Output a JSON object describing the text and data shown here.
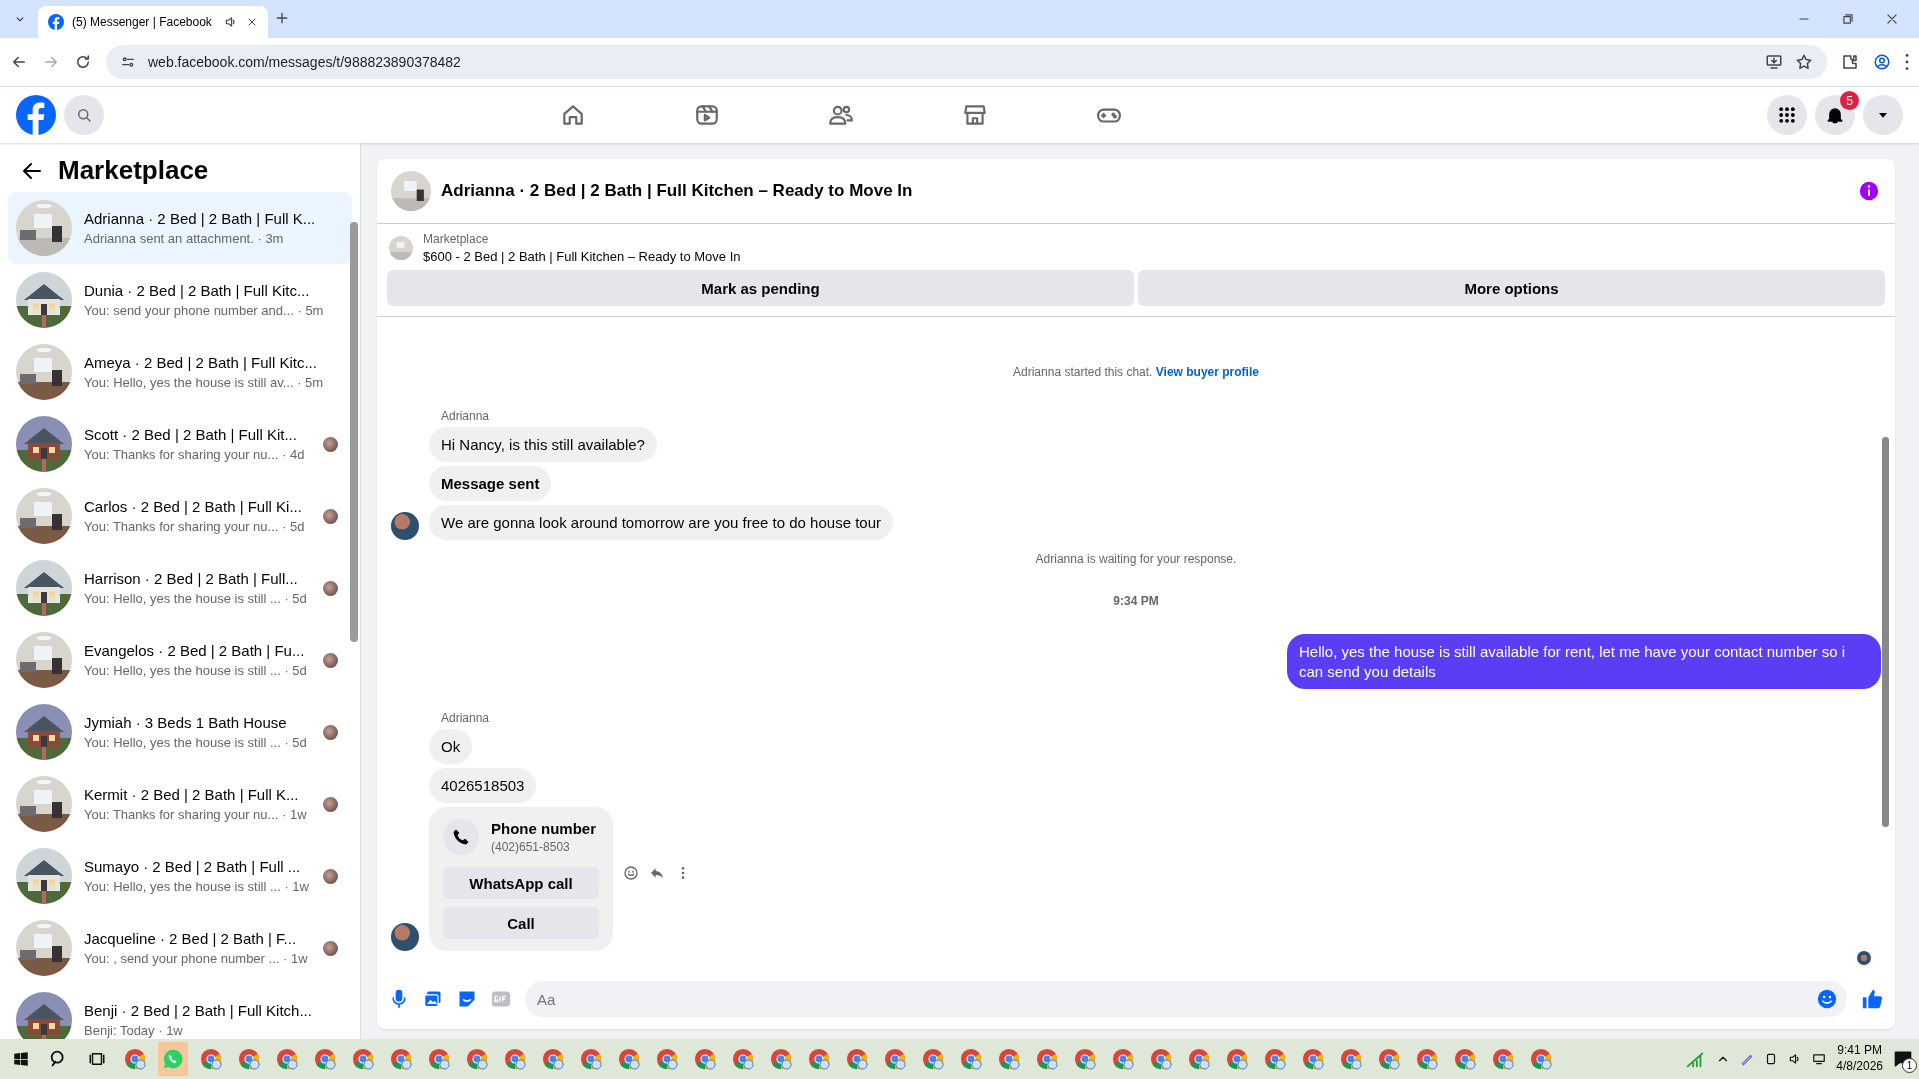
{
  "browser": {
    "tab_title": "(5) Messenger | Facebook",
    "url": "web.facebook.com/messages/t/988823890378482"
  },
  "header": {
    "notification_count": "5"
  },
  "sidebar": {
    "title": "Marketplace",
    "conversations": [
      {
        "name": "Adrianna · 2 Bed | 2 Bath | Full K...",
        "preview": "Adrianna sent an attachment. · 3m",
        "selected": true,
        "seen": false
      },
      {
        "name": "Dunia · 2 Bed | 2 Bath | Full Kitc...",
        "preview": "You: send your phone number and... · 5m",
        "selected": false,
        "seen": false
      },
      {
        "name": "Ameya · 2 Bed | 2 Bath | Full Kitc...",
        "preview": "You: Hello, yes the house is still av... · 5m",
        "selected": false,
        "seen": false
      },
      {
        "name": "Scott · 2 Bed | 2 Bath | Full Kit...",
        "preview": "You: Thanks for sharing your nu... · 4d",
        "selected": false,
        "seen": true
      },
      {
        "name": "Carlos · 2 Bed | 2 Bath | Full Ki...",
        "preview": "You: Thanks for sharing your nu... · 5d",
        "selected": false,
        "seen": true
      },
      {
        "name": "Harrison · 2 Bed | 2 Bath | Full...",
        "preview": "You: Hello, yes the house is still ... · 5d",
        "selected": false,
        "seen": true
      },
      {
        "name": "Evangelos · 2 Bed | 2 Bath | Fu...",
        "preview": "You: Hello, yes the house is still ... · 5d",
        "selected": false,
        "seen": true
      },
      {
        "name": "Jymiah · 3 Beds 1 Bath House",
        "preview": "You: Hello, yes the house is still ... · 5d",
        "selected": false,
        "seen": true
      },
      {
        "name": "Kermit · 2 Bed | 2 Bath | Full K...",
        "preview": "You: Thanks for sharing your nu... · 1w",
        "selected": false,
        "seen": true
      },
      {
        "name": "Sumayo · 2 Bed | 2 Bath | Full ...",
        "preview": "You: Hello, yes the house is still ... · 1w",
        "selected": false,
        "seen": true
      },
      {
        "name": "Jacqueline · 2 Bed | 2 Bath | F...",
        "preview": "You: , send your phone number ... · 1w",
        "selected": false,
        "seen": true
      },
      {
        "name": "Benji · 2 Bed | 2 Bath | Full Kitch...",
        "preview": "Benji: Today · 1w",
        "selected": false,
        "seen": false
      }
    ]
  },
  "chat": {
    "title": "Adrianna · 2 Bed | 2 Bath | Full Kitchen – Ready to Move In",
    "listing": {
      "label": "Marketplace",
      "title": "$600 - 2 Bed | 2 Bath | Full Kitchen – Ready to Move In"
    },
    "actions": [
      "Mark as pending",
      "More options"
    ],
    "messages": [
      {
        "kind": "system",
        "text": "Adrianna started this chat.",
        "link": "View buyer profile"
      },
      {
        "kind": "sender",
        "text": "Adrianna"
      },
      {
        "kind": "incoming",
        "text": "Hi Nancy, is this still available?",
        "bold": false,
        "avatar": false
      },
      {
        "kind": "incoming",
        "text": "Message sent",
        "bold": true,
        "avatar": false
      },
      {
        "kind": "incoming",
        "text": "We are gonna look around tomorrow are you free to do house tour",
        "bold": false,
        "avatar": true
      },
      {
        "kind": "system",
        "text": "Adrianna is waiting for your response."
      },
      {
        "kind": "time",
        "text": "9:34 PM"
      },
      {
        "kind": "outgoing",
        "text": "Hello, yes the house is still available for rent, let me have your contact number so i can send you  details"
      },
      {
        "kind": "sender",
        "text": "Adrianna"
      },
      {
        "kind": "incoming",
        "text": "Ok",
        "bold": false,
        "avatar": false
      },
      {
        "kind": "incoming",
        "text": "4026518503",
        "bold": false,
        "avatar": false
      },
      {
        "kind": "contact",
        "title": "Phone number",
        "number": "(402)651-8503",
        "buttons": [
          "WhatsApp call",
          "Call"
        ],
        "avatar": true
      }
    ],
    "composer": {
      "placeholder": "Aa"
    }
  },
  "taskbar": {
    "time": "9:41 PM",
    "date": "4/8/2026",
    "notification_count": "1"
  }
}
